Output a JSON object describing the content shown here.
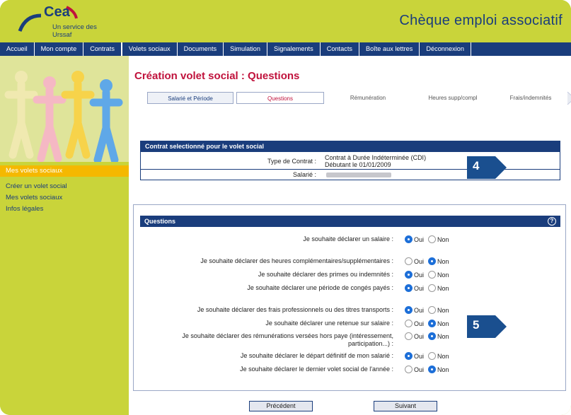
{
  "header": {
    "logo_text": "Cea",
    "logo_sub": "Un service des Urssaf",
    "app_title": "Chèque emploi associatif"
  },
  "nav": [
    "Accueil",
    "Mon compte",
    "Contrats",
    "Volets sociaux",
    "Documents",
    "Simulation",
    "Signalements",
    "Contacts",
    "Boîte aux lettres",
    "Déconnexion"
  ],
  "sidebar": {
    "section": "Mes volets sociaux",
    "links": [
      "Créer un volet social",
      "Mes volets sociaux",
      "Infos légales"
    ]
  },
  "main": {
    "title": "Création volet social : Questions",
    "steps": [
      "Salarié et Période",
      "Questions",
      "Rémunération",
      "Heures supp/compl",
      "Frais/indemnités"
    ],
    "contract": {
      "header": "Contrat selectionné pour le volet social",
      "type_label": "Type de Contrat :",
      "type_value": "Contrat à Durée Indéterminée (CDI)",
      "type_start": "Débutant le 01/01/2009",
      "employee_label": "Salarié :"
    },
    "questions": {
      "header": "Questions",
      "yes": "Oui",
      "no": "Non",
      "items": [
        {
          "label": "Je souhaite déclarer un salaire :",
          "answer": "Oui"
        },
        {
          "label": "Je souhaite déclarer des heures complémentaires/supplémentaires :",
          "answer": "Non"
        },
        {
          "label": "Je souhaite déclarer des primes ou indemnités :",
          "answer": "Oui"
        },
        {
          "label": "Je souhaite déclarer une période de congés payés :",
          "answer": "Oui"
        },
        {
          "label": "Je souhaite déclarer des frais professionnels ou des titres transports :",
          "answer": "Oui"
        },
        {
          "label": "Je souhaite déclarer une retenue sur salaire :",
          "answer": "Non"
        },
        {
          "label": "Je souhaite déclarer des rémunérations versées hors paye (intéressement,",
          "label2": "participation...) :",
          "answer": "Non"
        },
        {
          "label": "Je souhaite déclarer le départ définitif de mon salarié :",
          "answer": "Oui"
        },
        {
          "label": "Je souhaite déclarer le dernier volet social de l'année :",
          "answer": "Non"
        }
      ]
    },
    "buttons": {
      "prev": "Précédent",
      "next": "Suivant"
    },
    "badges": [
      "4",
      "5"
    ]
  },
  "colors": {
    "navy": "#1a3d7c",
    "lime": "#c9d43a",
    "crimson": "#c0123c",
    "badge": "#1a4f8f",
    "radio_on": "#1d6fd8"
  }
}
